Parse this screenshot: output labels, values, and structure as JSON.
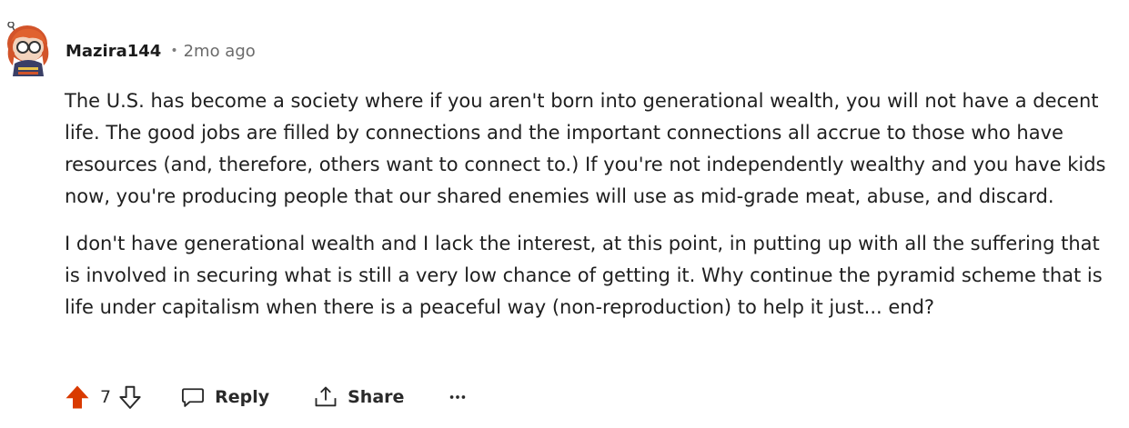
{
  "comment": {
    "username": "Mazira144",
    "separator": "•",
    "timestamp": "2mo ago",
    "paragraphs": [
      "The U.S. has become a society where if you aren't born into generational wealth, you will not have a decent life. The good jobs are filled by connections and the important connections all accrue to those who have resources (and, therefore, others want to connect to.) If you're not independently wealthy and you have kids now, you're producing people that our shared enemies will use as mid-grade meat, abuse, and discard.",
      "I don't have generational wealth and I lack the interest, at this point, in putting up with all the suffering that is involved in securing what is still a very low chance of getting it. Why continue the pyramid scheme that is life under capitalism when there is a peaceful way (non-reproduction) to help it just... end?"
    ]
  },
  "actions": {
    "score": "7",
    "reply_label": "Reply",
    "share_label": "Share",
    "more_label": "•••"
  },
  "icons": {
    "upvote": "arrow-up-filled-icon",
    "downvote": "arrow-down-outline-icon",
    "reply": "speech-bubble-icon",
    "share": "share-upload-icon",
    "more": "ellipsis-icon",
    "avatar": "user-avatar-icon"
  },
  "colors": {
    "upvote_active": "#D93A00",
    "text": "#1C1C1C",
    "meta": "#6B6B6B"
  }
}
